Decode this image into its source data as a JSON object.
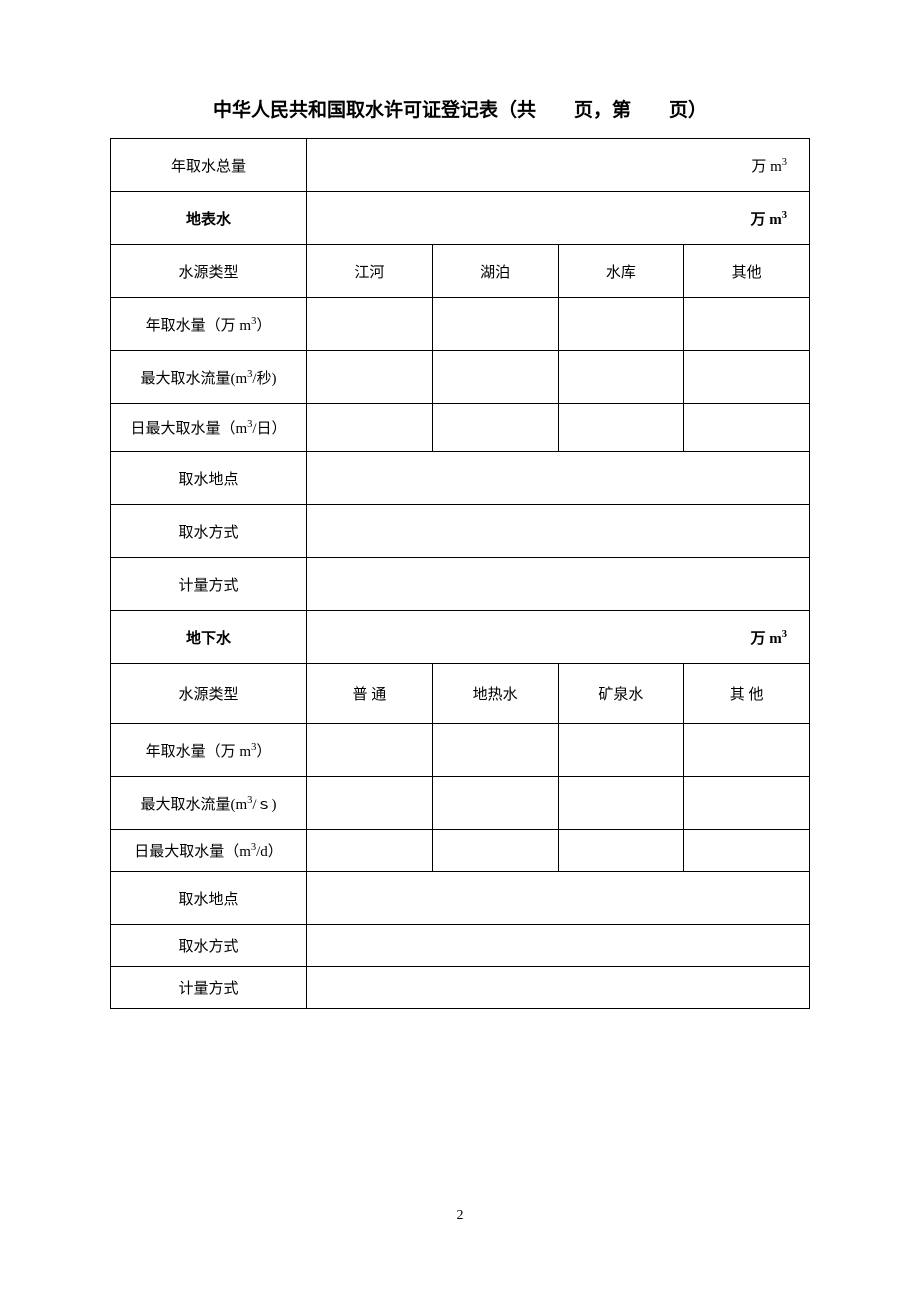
{
  "title": "中华人民共和国取水许可证登记表（共　　页，第　　页）",
  "unit_wanm3": "万 m³",
  "rows": {
    "annual_total": "年取水总量",
    "surface_water": "地表水",
    "source_type": "水源类型",
    "annual_intake": "年取水量（万 m³）",
    "max_flow_sec": "最大取水流量(m³/秒)",
    "daily_max_day": "日最大取水量（m³/日）",
    "intake_location": "取水地点",
    "intake_method": "取水方式",
    "measure_method": "计量方式",
    "groundwater": "地下水",
    "max_flow_s": "最大取水流量(m³/ｓ)",
    "daily_max_d": "日最大取水量（m³/d）"
  },
  "surface_types": {
    "river": "江河",
    "lake": "湖泊",
    "reservoir": "水库",
    "other": "其他"
  },
  "ground_types": {
    "ordinary": "普 通",
    "geothermal": "地热水",
    "mineral": "矿泉水",
    "other": "其 他"
  },
  "page_number": "2"
}
